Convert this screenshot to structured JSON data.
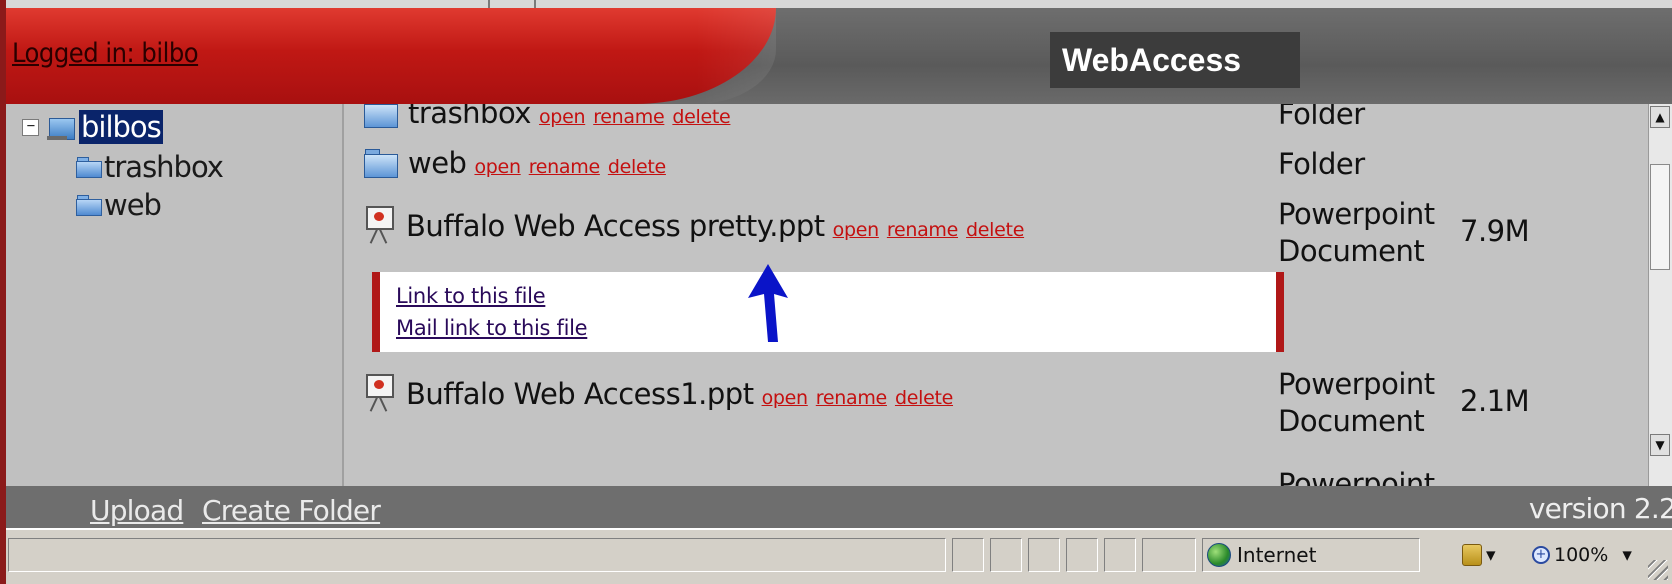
{
  "header": {
    "logged_in": "Logged in: bilbo",
    "brand": "WebAccess"
  },
  "tree": {
    "expander": "−",
    "root": "bilbos",
    "children": [
      "trashbox",
      "web"
    ]
  },
  "files": [
    {
      "name": "trashbox",
      "type": "Folder",
      "size": "",
      "actions": [
        "open",
        "rename",
        "delete"
      ]
    },
    {
      "name": "web",
      "type": "Folder",
      "size": "",
      "actions": [
        "open",
        "rename",
        "delete"
      ]
    },
    {
      "name": "Buffalo Web Access pretty.ppt",
      "type_line1": "Powerpoint",
      "type_line2": "Document",
      "size": "7.9M",
      "actions": [
        "open",
        "rename",
        "delete"
      ]
    },
    {
      "name": "Buffalo Web Access1.ppt",
      "type_line1": "Powerpoint",
      "type_line2": "Document",
      "size": "2.1M",
      "actions": [
        "open",
        "rename",
        "delete"
      ]
    },
    {
      "type_line1": "Powerpoint"
    }
  ],
  "share_box": {
    "link": "Link to this file",
    "mail": "Mail link to this file"
  },
  "footer": {
    "upload": "Upload",
    "create_folder": "Create Folder",
    "version": "version 2.2"
  },
  "statusbar": {
    "zone": "Internet",
    "zoom": "100%",
    "dropdown": "▾"
  },
  "scrollbar": {
    "up": "▲",
    "down": "▼"
  },
  "colors": {
    "accent_red": "#c01814",
    "link_red": "#c41010",
    "arrow_blue": "#0a14c8",
    "selection": "#0a246a"
  }
}
